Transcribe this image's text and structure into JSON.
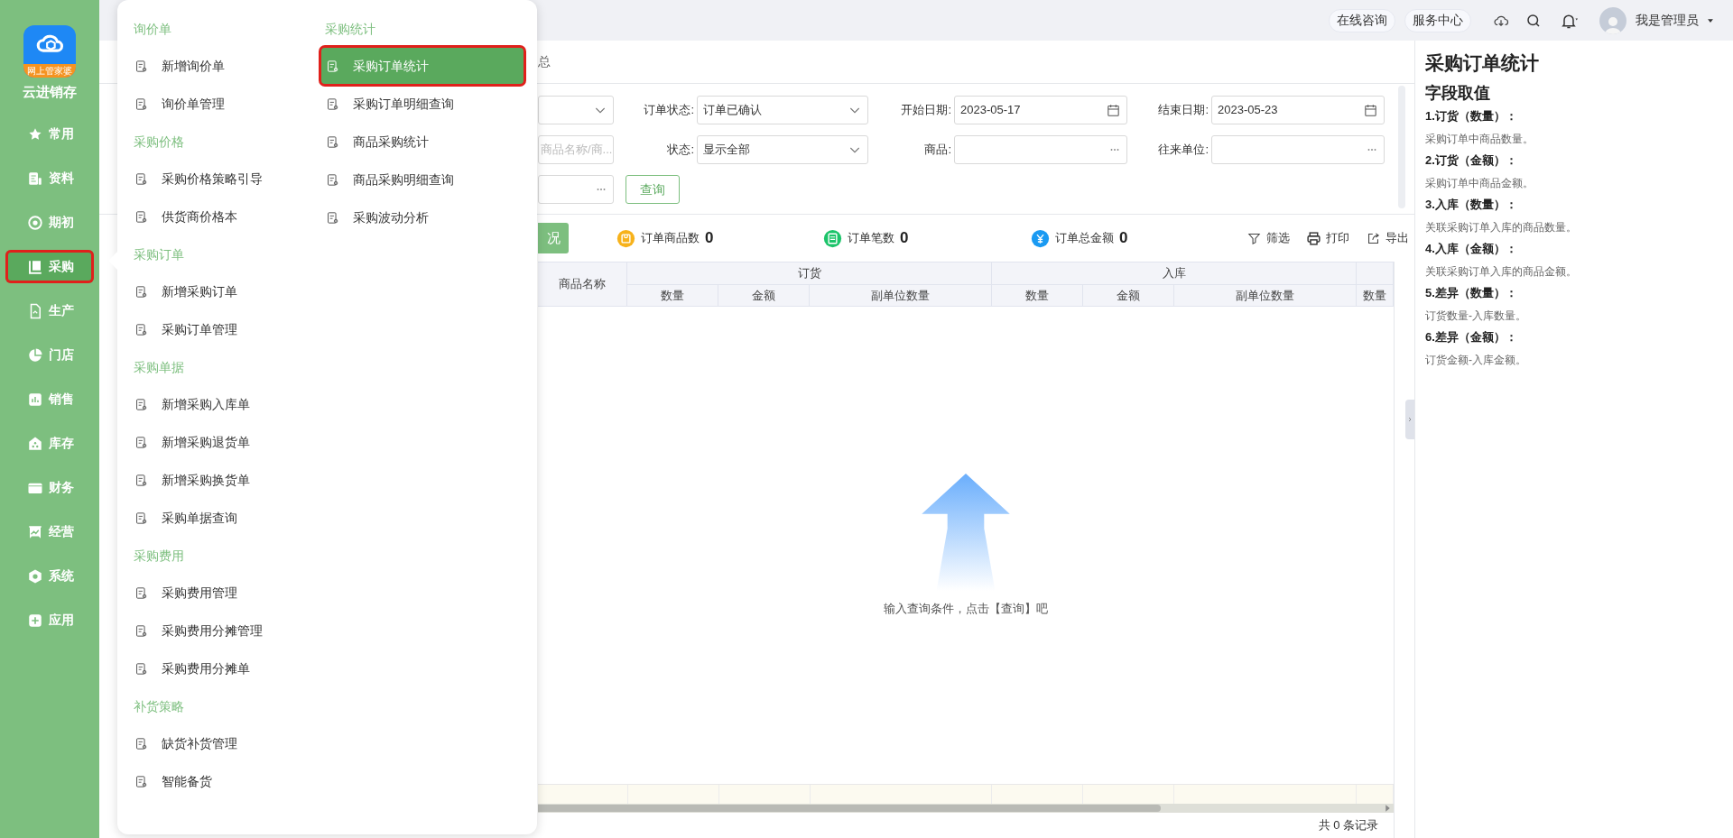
{
  "sidebar": {
    "logo_badge": "网上管家婆",
    "app_name": "云进销存",
    "items": [
      {
        "label": "常用",
        "kind": "star",
        "selected": false
      },
      {
        "label": "资料",
        "kind": "doc",
        "selected": false
      },
      {
        "label": "期初",
        "kind": "target",
        "selected": false
      },
      {
        "label": "采购",
        "kind": "book",
        "selected": true
      },
      {
        "label": "生产",
        "kind": "file",
        "selected": false
      },
      {
        "label": "门店",
        "kind": "pie",
        "selected": false
      },
      {
        "label": "销售",
        "kind": "bars",
        "selected": false
      },
      {
        "label": "库存",
        "kind": "house",
        "selected": false
      },
      {
        "label": "财务",
        "kind": "wallet",
        "selected": false
      },
      {
        "label": "经营",
        "kind": "chart",
        "selected": false
      },
      {
        "label": "系统",
        "kind": "hex",
        "selected": false
      },
      {
        "label": "应用",
        "kind": "plus",
        "selected": false
      }
    ]
  },
  "topbar": {
    "buttons": [
      "在线咨询",
      "服务中心"
    ],
    "user": "我是管理员"
  },
  "menu": {
    "columns": [
      {
        "groups": [
          {
            "title": "询价单",
            "items": [
              {
                "label": "新增询价单",
                "selected": false
              },
              {
                "label": "询价单管理",
                "selected": false
              }
            ]
          },
          {
            "title": "采购价格",
            "items": [
              {
                "label": "采购价格策略引导",
                "selected": false
              },
              {
                "label": "供货商价格本",
                "selected": false
              }
            ]
          },
          {
            "title": "采购订单",
            "items": [
              {
                "label": "新增采购订单",
                "selected": false
              },
              {
                "label": "采购订单管理",
                "selected": false
              }
            ]
          },
          {
            "title": "采购单据",
            "items": [
              {
                "label": "新增采购入库单",
                "selected": false
              },
              {
                "label": "新增采购退货单",
                "selected": false
              },
              {
                "label": "新增采购换货单",
                "selected": false
              },
              {
                "label": "采购单据查询",
                "selected": false
              }
            ]
          },
          {
            "title": "采购费用",
            "items": [
              {
                "label": "采购费用管理",
                "selected": false
              },
              {
                "label": "采购费用分摊管理",
                "selected": false
              },
              {
                "label": "采购费用分摊单",
                "selected": false
              }
            ]
          },
          {
            "title": "补货策略",
            "items": [
              {
                "label": "缺货补货管理",
                "selected": false
              },
              {
                "label": "智能备货",
                "selected": false
              }
            ]
          }
        ]
      },
      {
        "groups": [
          {
            "title": "采购统计",
            "items": [
              {
                "label": "采购订单统计",
                "selected": true
              },
              {
                "label": "采购订单明细查询",
                "selected": false
              },
              {
                "label": "商品采购统计",
                "selected": false
              },
              {
                "label": "商品采购明细查询",
                "selected": false
              },
              {
                "label": "采购波动分析",
                "selected": false
              }
            ]
          }
        ]
      }
    ]
  },
  "tabs": [
    {
      "label": "总",
      "selected": false
    }
  ],
  "filters": {
    "rows": [
      [
        {
          "kind": "select"
        },
        {
          "label": "订单状态:",
          "kind": "select",
          "value": "订单已确认"
        },
        {
          "label": "开始日期:",
          "kind": "date",
          "value": "2023-05-17"
        },
        {
          "label": "结束日期:",
          "kind": "date",
          "value": "2023-05-23"
        }
      ],
      [
        {
          "kind": "text",
          "placeholder": "商品名称/商..."
        },
        {
          "label": "状态:",
          "kind": "select",
          "value": "显示全部"
        },
        {
          "label": "商品:",
          "kind": "picker"
        },
        {
          "label": "往来单位:",
          "kind": "picker"
        }
      ],
      [
        {
          "kind": "picker"
        }
      ]
    ],
    "query_button": "查询"
  },
  "summary": {
    "report_button": "况",
    "stats": [
      {
        "label": "订单商品数",
        "value": "0",
        "color": "#f7b21b"
      },
      {
        "label": "订单笔数",
        "value": "0",
        "color": "#1cc46a"
      },
      {
        "label": "订单总金额",
        "value": "0",
        "color": "#1a9af2"
      }
    ],
    "actions": [
      {
        "label": "筛选",
        "kind": "filter"
      },
      {
        "label": "打印",
        "kind": "print"
      },
      {
        "label": "导出",
        "kind": "export"
      }
    ]
  },
  "table": {
    "columns": [
      {
        "label": "商品名称"
      },
      {
        "label": "订货",
        "children": [
          "数量",
          "金额",
          "副单位数量"
        ]
      },
      {
        "label": "入库",
        "children": [
          "数量",
          "金额",
          "副单位数量"
        ]
      },
      {
        "children": [
          "数量"
        ]
      }
    ],
    "empty_text": "输入查询条件，点击【查询】吧",
    "footer": "共 0 条记录"
  },
  "help": {
    "title": "采购订单统计",
    "subtitle": "字段取值",
    "fields": [
      {
        "name": "1.订货（数量）：",
        "desc": "采购订单中商品数量。"
      },
      {
        "name": "2.订货（金额）：",
        "desc": "采购订单中商品金额。"
      },
      {
        "name": "3.入库（数量）：",
        "desc": "关联采购订单入库的商品数量。"
      },
      {
        "name": "4.入库（金额）：",
        "desc": "关联采购订单入库的商品金额。"
      },
      {
        "name": "5.差异（数量）：",
        "desc": "订货数量-入库数量。"
      },
      {
        "name": "6.差异（金额）：",
        "desc": "订货金额-入库金额。"
      }
    ]
  }
}
